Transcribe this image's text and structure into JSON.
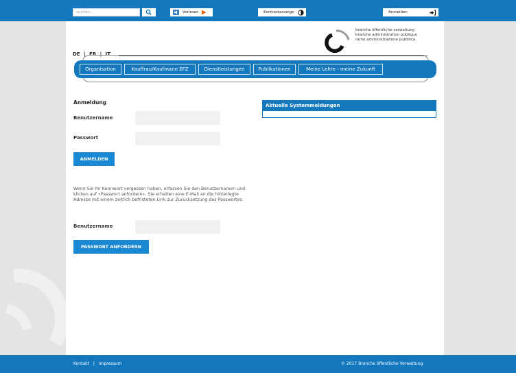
{
  "topbar": {
    "search_placeholder": "suchen...",
    "read_label": "Vorlesen",
    "contrast_label": "Kontrastanzeige",
    "login_label": "Anmelden"
  },
  "brand": {
    "line1": "branche öffentliche verwaltung",
    "line2": "branche administration publique",
    "line3": "ramo amministrazione pubblica"
  },
  "languages": [
    "DE",
    "|",
    "FR",
    "|",
    "IT"
  ],
  "nav": [
    "Organisation",
    "Kauffrau/Kaufmann EFZ",
    "Dienstleistungen",
    "Publikationen",
    "Meine Lehre - meine Zukunft"
  ],
  "login": {
    "heading": "Anmeldung",
    "username_label": "Benutzername",
    "password_label": "Passwort",
    "submit_label": "ANMELDEN"
  },
  "reset": {
    "info": "Wenn Sie Ihr Kennwort vergessen haben, erfassen Sie den Benutzernamen und klicken auf «Passwort anfordern». Sie erhalten eine E-Mail an die hinterlegte Adresse mit einem zeitlich befristeten Link zur Zurücksetzung des Passwortes.",
    "username_label": "Benutzername",
    "submit_label": "PASSWORT ANFORDERN"
  },
  "system_messages": {
    "heading": "Aktuelle Systemmeldungen"
  },
  "footer": {
    "contact": "Kontakt",
    "separator": "|",
    "imprint": "Impressum",
    "copyright": "© 2017 Branche öffentliche Verwaltung"
  },
  "colors": {
    "brand_blue": "#1478bf",
    "button_blue": "#1a88d3",
    "play_orange": "#e8630a"
  },
  "icons": {
    "search": "search-icon",
    "read": "speaker-icon",
    "play": "play-icon",
    "contrast": "contrast-icon",
    "login": "login-icon"
  }
}
